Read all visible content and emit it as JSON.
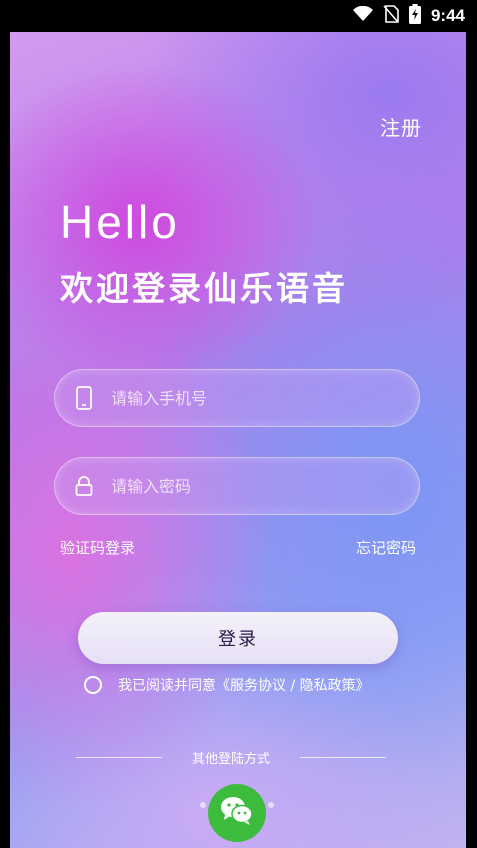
{
  "status_bar": {
    "time": "9:44",
    "icons": [
      "wifi-icon",
      "no-sim-icon",
      "battery-charging-icon"
    ]
  },
  "header": {
    "register_label": "注册"
  },
  "greeting": {
    "hello": "Hello",
    "welcome": "欢迎登录仙乐语音"
  },
  "form": {
    "phone_placeholder": "请输入手机号",
    "password_placeholder": "请输入密码",
    "sms_login_label": "验证码登录",
    "forgot_password_label": "忘记密码",
    "login_button_label": "登录"
  },
  "agreement": {
    "text": "我已阅读并同意",
    "policy_link": "《服务协议 / 隐私政策》"
  },
  "other_login": {
    "label": "其他登陆方式",
    "methods": [
      "wechat-icon"
    ]
  },
  "colors": {
    "wechat_green": "#3dbb3c",
    "accent_purple": "#b07ce9",
    "accent_blue": "#93a2f3"
  }
}
